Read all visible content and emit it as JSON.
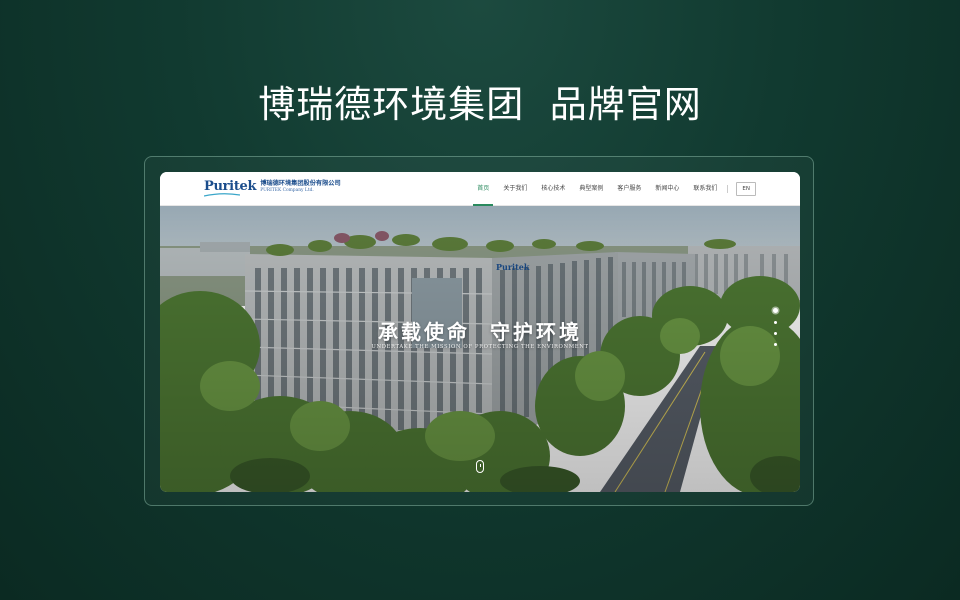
{
  "headline": "博瑞德环境集团  品牌官网",
  "site": {
    "logo_mark": "Puritek",
    "logo_cn": "博瑞德环境集团股份有限公司",
    "logo_en": "PURITEK Company Ltd.",
    "nav": [
      {
        "label": "首页",
        "active": true
      },
      {
        "label": "关于我们",
        "active": false
      },
      {
        "label": "核心技术",
        "active": false
      },
      {
        "label": "典型案例",
        "active": false
      },
      {
        "label": "客户服务",
        "active": false
      },
      {
        "label": "新闻中心",
        "active": false
      },
      {
        "label": "联系我们",
        "active": false
      }
    ],
    "lang": "EN"
  },
  "hero": {
    "title": "承载使命  守护环境",
    "subtitle": "UNDERTAKE THE MISSION OF PROTECTING THE ENVIRONMENT",
    "building_sign": "Puritek",
    "slide_count": 4,
    "active_slide": 1
  },
  "colors": {
    "background": "#113a30",
    "accent": "#2a8a5e",
    "brand_blue": "#1b4d8c"
  }
}
